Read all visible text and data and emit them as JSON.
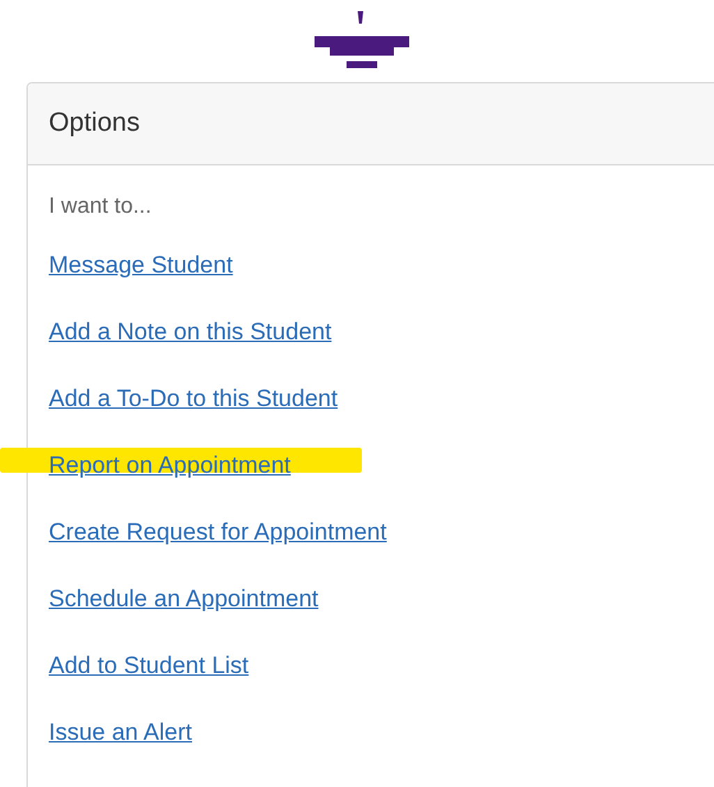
{
  "panel": {
    "title": "Options",
    "intro": "I want to...",
    "links": [
      {
        "label": "Message Student",
        "highlighted": false
      },
      {
        "label": "Add a Note on this Student",
        "highlighted": false
      },
      {
        "label": "Add a To-Do to this Student",
        "highlighted": false
      },
      {
        "label": "Report on Appointment",
        "highlighted": true
      },
      {
        "label": "Create Request for Appointment",
        "highlighted": false
      },
      {
        "label": "Schedule an Appointment",
        "highlighted": false
      },
      {
        "label": "Add to Student List",
        "highlighted": false
      },
      {
        "label": "Issue an Alert",
        "highlighted": false
      }
    ]
  }
}
